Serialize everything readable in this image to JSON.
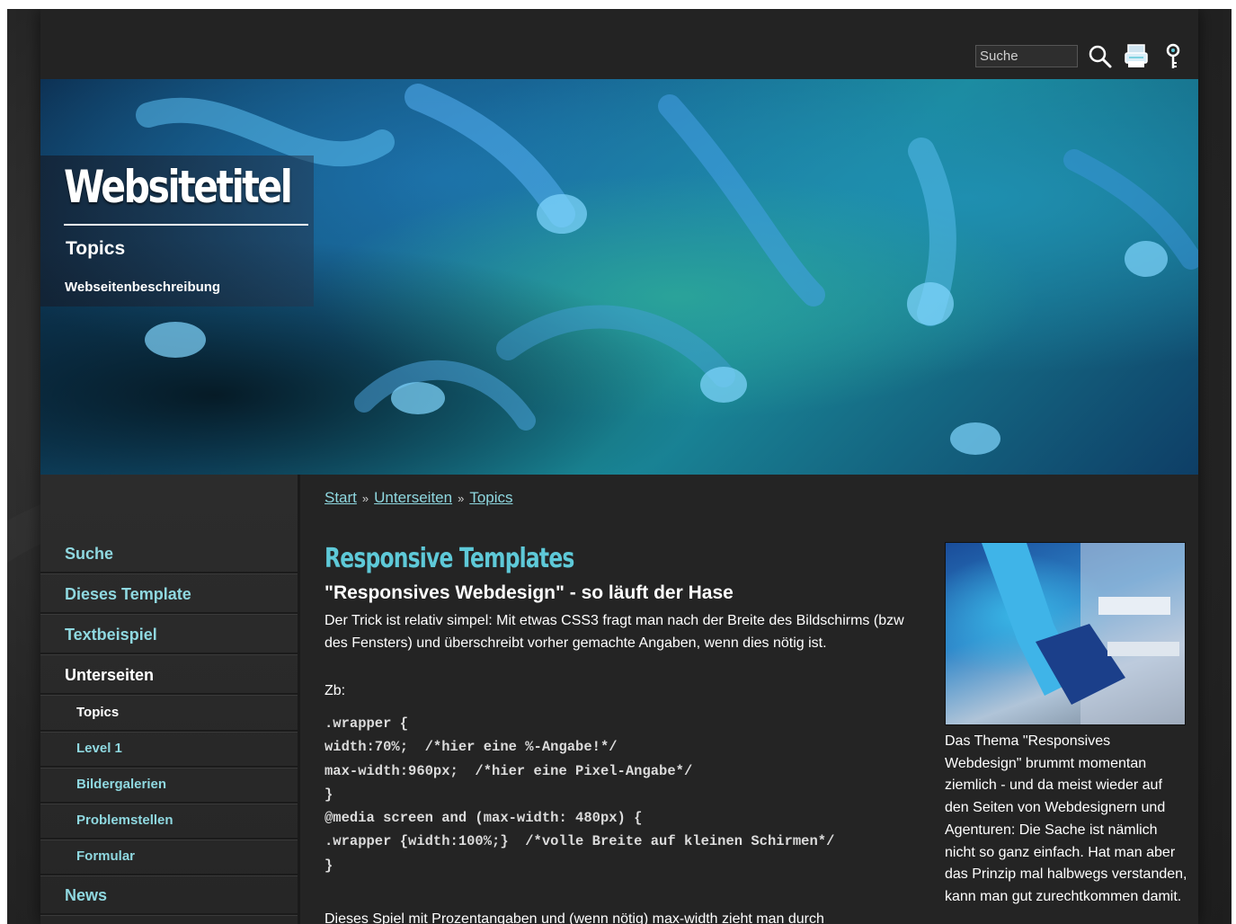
{
  "topbar": {
    "search_placeholder": "Suche",
    "icons": [
      "search-icon",
      "print-icon",
      "key-icon"
    ]
  },
  "header": {
    "site_title": "Websitetitel",
    "topic": "Topics",
    "description": "Webseitenbeschreibung"
  },
  "sidebar": {
    "items": [
      {
        "label": "Suche"
      },
      {
        "label": "Dieses Template"
      },
      {
        "label": "Textbeispiel"
      },
      {
        "label": "Unterseiten"
      },
      {
        "label": "Topics"
      },
      {
        "label": "Level 1"
      },
      {
        "label": "Bildergalerien"
      },
      {
        "label": "Problemstellen"
      },
      {
        "label": "Formular"
      },
      {
        "label": "News"
      }
    ]
  },
  "breadcrumb": {
    "items": [
      "Start",
      "Unterseiten",
      "Topics"
    ],
    "separator": "»"
  },
  "article": {
    "title": "Responsive Templates",
    "subtitle": "\"Responsives Webdesign\" - so läuft der Hase",
    "intro": "Der Trick ist relativ simpel: Mit etwas CSS3 fragt man nach der Breite des Bildschirms (bzw des Fensters) und überschreibt vorher gemachte Angaben, wenn dies nötig ist.",
    "zb": "Zb:",
    "code": [
      ".wrapper {",
      "width:70%;  /*hier eine %-Angabe!*/",
      "max-width:960px;  /*hier eine Pixel-Angabe*/",
      "}",
      "@media screen and (max-width: 480px) {",
      ".wrapper {width:100%;}  /*volle Breite auf kleinen Schirmen*/",
      "}"
    ],
    "more": "Dieses Spiel mit Prozentangaben und (wenn nötig) max-width zieht man durch"
  },
  "aside": {
    "text": "Das Thema \"Responsives Webdesign\" brummt momentan ziemlich - und da meist wieder auf den Seiten von Webdesignern und Agenturen: Die Sache ist nämlich nicht so ganz einfach. Hat man aber das Prinzip mal halbwegs verstanden, kann man gut zurechtkommen damit."
  },
  "colors": {
    "accent": "#5ec9d8",
    "link": "#8fd8e0",
    "background": "#242424"
  }
}
